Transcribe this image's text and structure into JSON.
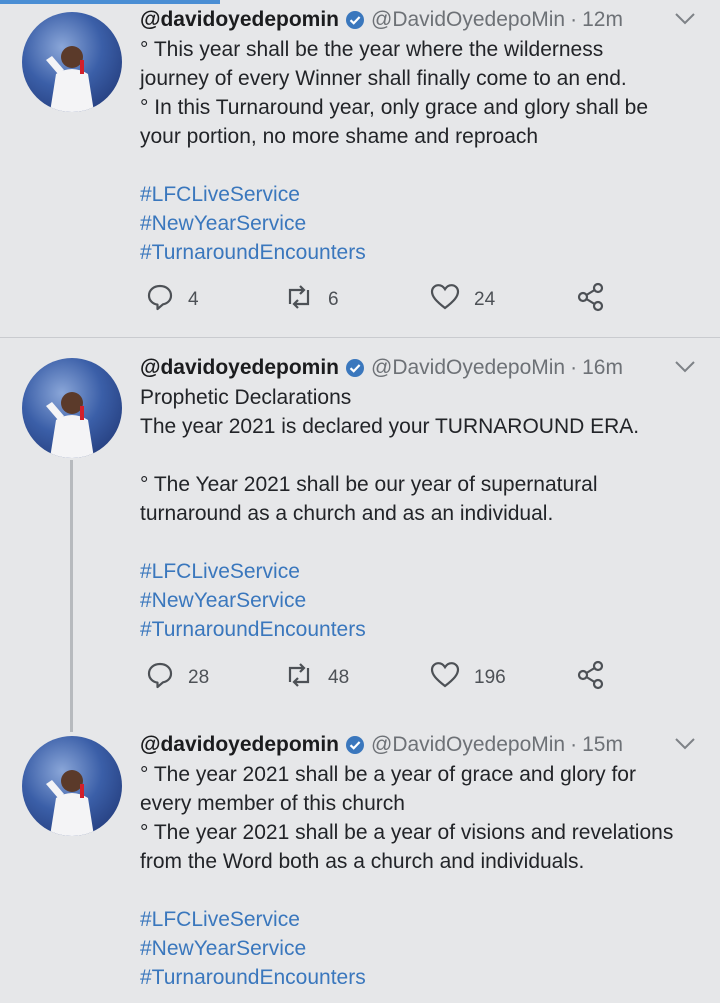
{
  "tweets": [
    {
      "name": "@davidoyedepomin",
      "handle": "@DavidOyedepoMin",
      "time": "12m",
      "lines": [
        "° This year shall be the year where the wilderness",
        "journey of every Winner shall finally come to an end.",
        "° In this Turnaround year, only grace and glory shall be",
        "your portion, no more shame and reproach"
      ],
      "hashtags": [
        "#LFCLiveService",
        "#NewYearService",
        "#TurnaroundEncounters"
      ],
      "replies": "4",
      "retweets": "6",
      "likes": "24"
    },
    {
      "name": "@davidoyedepomin",
      "handle": "@DavidOyedepoMin",
      "time": "16m",
      "lines": [
        "Prophetic Declarations",
        "The year 2021 is declared your TURNAROUND ERA.",
        "",
        "° The Year 2021 shall be our year of supernatural",
        "turnaround as a church and as an individual."
      ],
      "hashtags": [
        "#LFCLiveService",
        "#NewYearService",
        "#TurnaroundEncounters"
      ],
      "replies": "28",
      "retweets": "48",
      "likes": "196"
    },
    {
      "name": "@davidoyedepomin",
      "handle": "@DavidOyedepoMin",
      "time": "15m",
      "lines": [
        "° The year 2021 shall be a year of grace and glory for",
        "every member of this church",
        "° The year 2021 shall be a year of visions and revelations",
        "from the Word both as a church and individuals."
      ],
      "hashtags": [
        "#LFCLiveService",
        "#NewYearService",
        "#TurnaroundEncounters"
      ]
    }
  ],
  "separator": "·",
  "colors": {
    "background": "#e6e7e9",
    "link": "#3a77bd",
    "verified": "#3a77bd",
    "muted": "#6d7176"
  }
}
